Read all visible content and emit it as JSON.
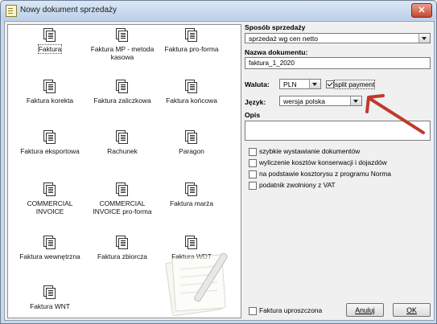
{
  "window": {
    "title": "Nowy dokument sprzedaży",
    "close_glyph": "✕"
  },
  "documents": [
    {
      "label": "Faktura",
      "selected": true
    },
    {
      "label": "Faktura MP - metoda kasowa"
    },
    {
      "label": "Faktura pro-forma"
    },
    {
      "label": "Faktura korekta"
    },
    {
      "label": "Faktura zaliczkowa"
    },
    {
      "label": "Faktura końcowa"
    },
    {
      "label": "Faktura eksportowa"
    },
    {
      "label": "Rachunek"
    },
    {
      "label": "Paragon"
    },
    {
      "label": "COMMERCIAL INVOICE"
    },
    {
      "label": "COMMERCIAL INVOICE pro-forma"
    },
    {
      "label": "Faktura marża"
    },
    {
      "label": "Faktura wewnętrzna"
    },
    {
      "label": "Faktura zbiorcza"
    },
    {
      "label": "Faktura WDT"
    },
    {
      "label": "Faktura WNT"
    }
  ],
  "form": {
    "sposob_label": "Sposób sprzedaży",
    "sposob_value": "sprzedaż wg cen netto",
    "nazwa_label": "Nazwa dokumentu:",
    "nazwa_value": "faktura_1_2020",
    "waluta_label": "Waluta:",
    "waluta_value": "PLN",
    "split_payment_label": "split payment",
    "split_payment_checked": true,
    "jezyk_label": "Język:",
    "jezyk_value": "wersja polska",
    "opis_label": "Opis",
    "opis_value": "",
    "options": [
      {
        "label": "szybkie wystawianie dokumentów",
        "checked": false
      },
      {
        "label": "wyliczenie kosztów konserwacji i dojazdów",
        "checked": false
      },
      {
        "label": "na podstawie kosztorysu z programu Norma",
        "checked": false
      },
      {
        "label": "podatnik zwolniony z VAT",
        "checked": false
      }
    ],
    "uproszczona_label": "Faktura uproszczona",
    "uproszczona_checked": false
  },
  "buttons": {
    "cancel": "Anuluj",
    "ok": "OK"
  },
  "colors": {
    "arrow": "#c0392b",
    "close": "#c6462f"
  }
}
